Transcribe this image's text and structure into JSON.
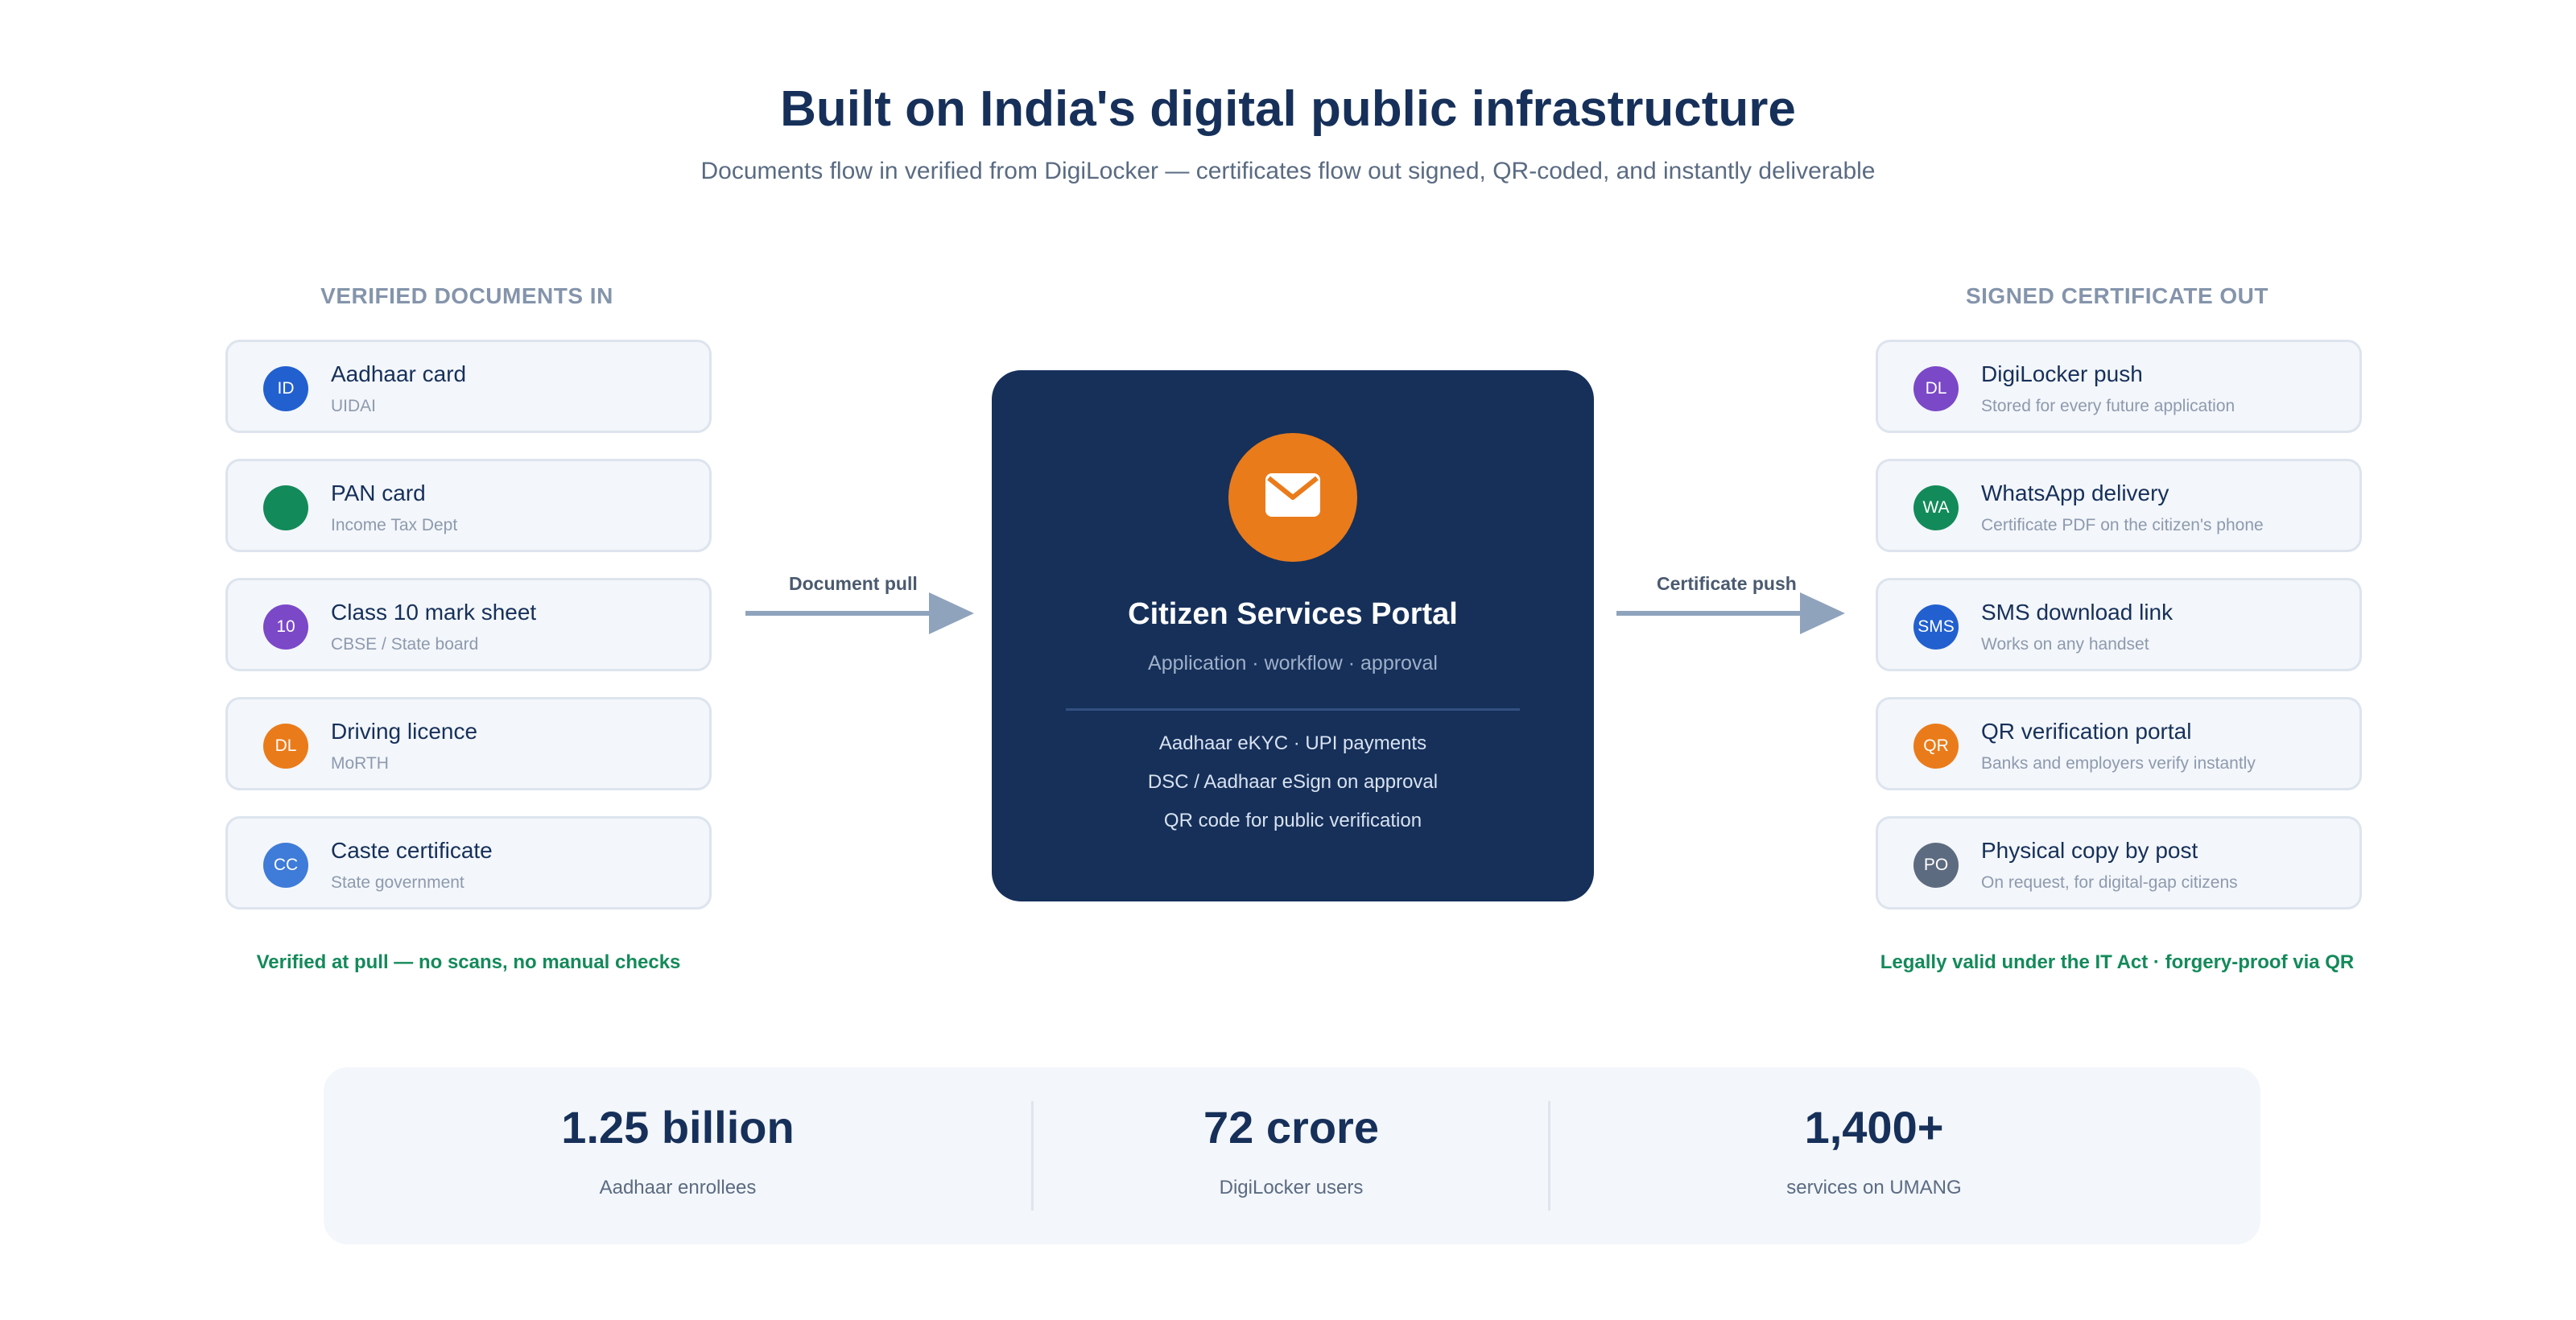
{
  "title": "Built on India's digital public infrastructure",
  "subtitle": "Documents flow in verified from DigiLocker — certificates flow out signed, QR-coded, and instantly deliverable",
  "inputs": {
    "heading": "VERIFIED DOCUMENTS IN",
    "items": [
      {
        "badge": "ID",
        "badge_color": "#2260d0",
        "title": "Aadhaar card",
        "subtitle": "UIDAI"
      },
      {
        "badge": "",
        "badge_color": "#138a5a",
        "title": "PAN card",
        "subtitle": "Income Tax Dept"
      },
      {
        "badge": "10",
        "badge_color": "#7b48c8",
        "title": "Class 10 mark sheet",
        "subtitle": "CBSE / State board"
      },
      {
        "badge": "DL",
        "badge_color": "#ea7b1a",
        "title": "Driving licence",
        "subtitle": "MoRTH"
      },
      {
        "badge": "CC",
        "badge_color": "#3f7bd8",
        "title": "Caste certificate",
        "subtitle": "State government"
      }
    ],
    "footnote": "Verified at pull — no scans, no manual checks"
  },
  "arrows": {
    "pull_label": "Document pull",
    "push_label": "Certificate push"
  },
  "portal": {
    "icon": "envelope-icon",
    "title": "Citizen Services Portal",
    "tagline": "Application · workflow · approval",
    "features": [
      "Aadhaar eKYC · UPI payments",
      "DSC / Aadhaar eSign on approval",
      "QR code for public verification"
    ]
  },
  "outputs": {
    "heading": "SIGNED CERTIFICATE OUT",
    "items": [
      {
        "badge": "DL",
        "badge_color": "#7b48c8",
        "title": "DigiLocker push",
        "subtitle": "Stored for every future application"
      },
      {
        "badge": "WA",
        "badge_color": "#138a5a",
        "title": "WhatsApp delivery",
        "subtitle": "Certificate PDF on the citizen's phone"
      },
      {
        "badge": "SMS",
        "badge_color": "#2260d0",
        "title": "SMS download link",
        "subtitle": "Works on any handset"
      },
      {
        "badge": "QR",
        "badge_color": "#ea7b1a",
        "title": "QR verification portal",
        "subtitle": "Banks and employers verify instantly"
      },
      {
        "badge": "PO",
        "badge_color": "#5d6b80",
        "title": "Physical copy by post",
        "subtitle": "On request, for digital-gap citizens"
      }
    ],
    "footnote": "Legally valid under the IT Act · forgery-proof via QR"
  },
  "stats": [
    {
      "value": "1.25 billion",
      "label": "Aadhaar enrollees"
    },
    {
      "value": "72 crore",
      "label": "DigiLocker users"
    },
    {
      "value": "1,400+",
      "label": "services on UMANG"
    }
  ],
  "colors": {
    "navy": "#16305a",
    "accent_orange": "#ea7b1a",
    "success_green": "#138a5a",
    "arrow_gray": "#8fa3bd"
  }
}
